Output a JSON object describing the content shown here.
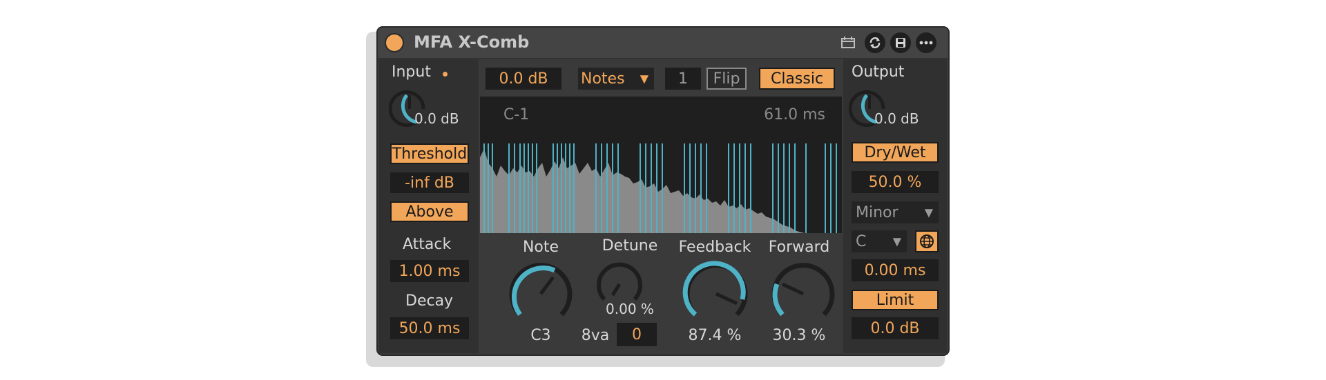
{
  "device": {
    "title": "MFA X-Comb"
  },
  "input": {
    "label": "Input",
    "value": "0.0 dB"
  },
  "threshold": {
    "label": "Threshold",
    "value": "-inf dB",
    "mode": "Above"
  },
  "attack": {
    "label": "Attack",
    "value": "1.00 ms"
  },
  "decay": {
    "label": "Decay",
    "value": "50.0 ms"
  },
  "toolbar": {
    "gain": "0.0 dB",
    "mode": "Notes",
    "count": "1",
    "flip": "Flip",
    "classic": "Classic"
  },
  "display": {
    "note": "C-1",
    "time": "61.0 ms"
  },
  "knobs": {
    "note": {
      "label": "Note",
      "value": "C3",
      "level": 0.6
    },
    "detune": {
      "label": "Detune",
      "value": "0.00 %",
      "level": 0.5
    },
    "feedback": {
      "label": "Feedback",
      "value": "87.4 %",
      "level": 0.874
    },
    "forward": {
      "label": "Forward",
      "value": "30.3 %",
      "level": 0.303
    }
  },
  "octave": {
    "label": "8va",
    "value": "0"
  },
  "output": {
    "label": "Output",
    "value": "0.0 dB",
    "drywet_label": "Dry/Wet",
    "drywet": "50.0 %",
    "scale": "Minor",
    "key": "C",
    "time": "0.00 ms",
    "limit_label": "Limit",
    "limit": "0.0 dB"
  },
  "icons": [
    "calendar-icon",
    "refresh-icon",
    "save-icon",
    "more-icon",
    "globe-icon"
  ],
  "colors": {
    "accent": "#f2a65a",
    "cyan": "#4fb3c8",
    "bg": "#3a3a3a"
  }
}
